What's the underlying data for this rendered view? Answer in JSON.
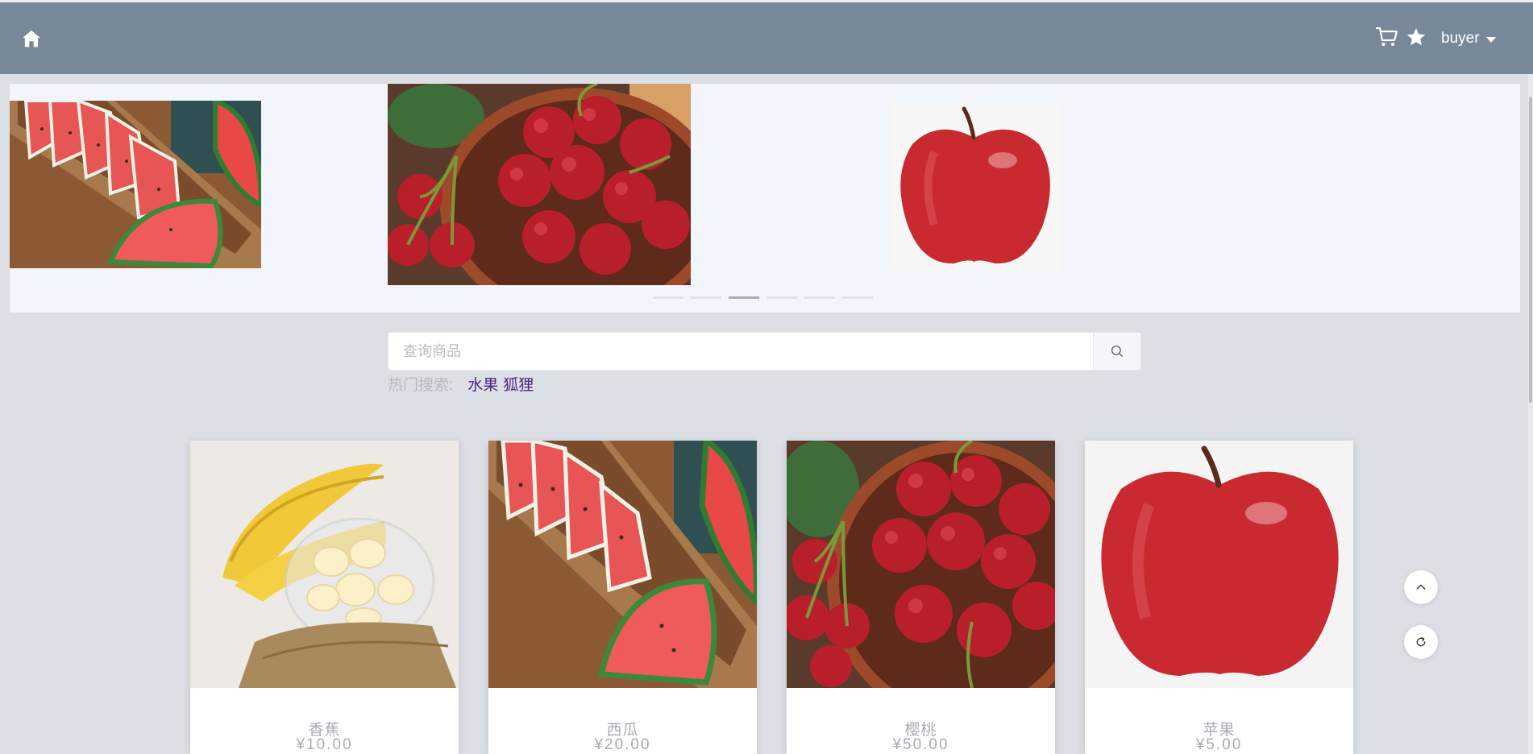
{
  "header": {
    "home_icon": "home-icon",
    "cart_icon": "cart-icon",
    "favorites_icon": "star-icon",
    "username": "buyer",
    "user_menu_icon": "caret-down-icon"
  },
  "carousel": {
    "slides": [
      {
        "name": "watermelon-slide",
        "image": "watermelon"
      },
      {
        "name": "cherry-slide",
        "image": "cherry"
      },
      {
        "name": "apple-slide",
        "image": "apple"
      }
    ],
    "indicator_count": 6,
    "active_index": 2
  },
  "search": {
    "placeholder": "查询商品",
    "value": "",
    "button_icon": "search-icon",
    "hot_label": "热门搜索:",
    "hot_terms": [
      "水果",
      "狐狸"
    ]
  },
  "products": [
    {
      "name": "香蕉",
      "price": "¥10.00",
      "image": "banana"
    },
    {
      "name": "西瓜",
      "price": "¥20.00",
      "image": "watermelon"
    },
    {
      "name": "樱桃",
      "price": "¥50.00",
      "image": "cherry"
    },
    {
      "name": "苹果",
      "price": "¥5.00",
      "image": "apple"
    }
  ],
  "float_buttons": {
    "back_to_top_icon": "chevron-up-icon",
    "refresh_icon": "refresh-icon"
  },
  "colors": {
    "navbar": "#778899",
    "page_background": "#dcdfe6",
    "carousel_background": "#f2f6fc",
    "hot_link": "#4a2582",
    "muted_text": "#a9acb2"
  }
}
